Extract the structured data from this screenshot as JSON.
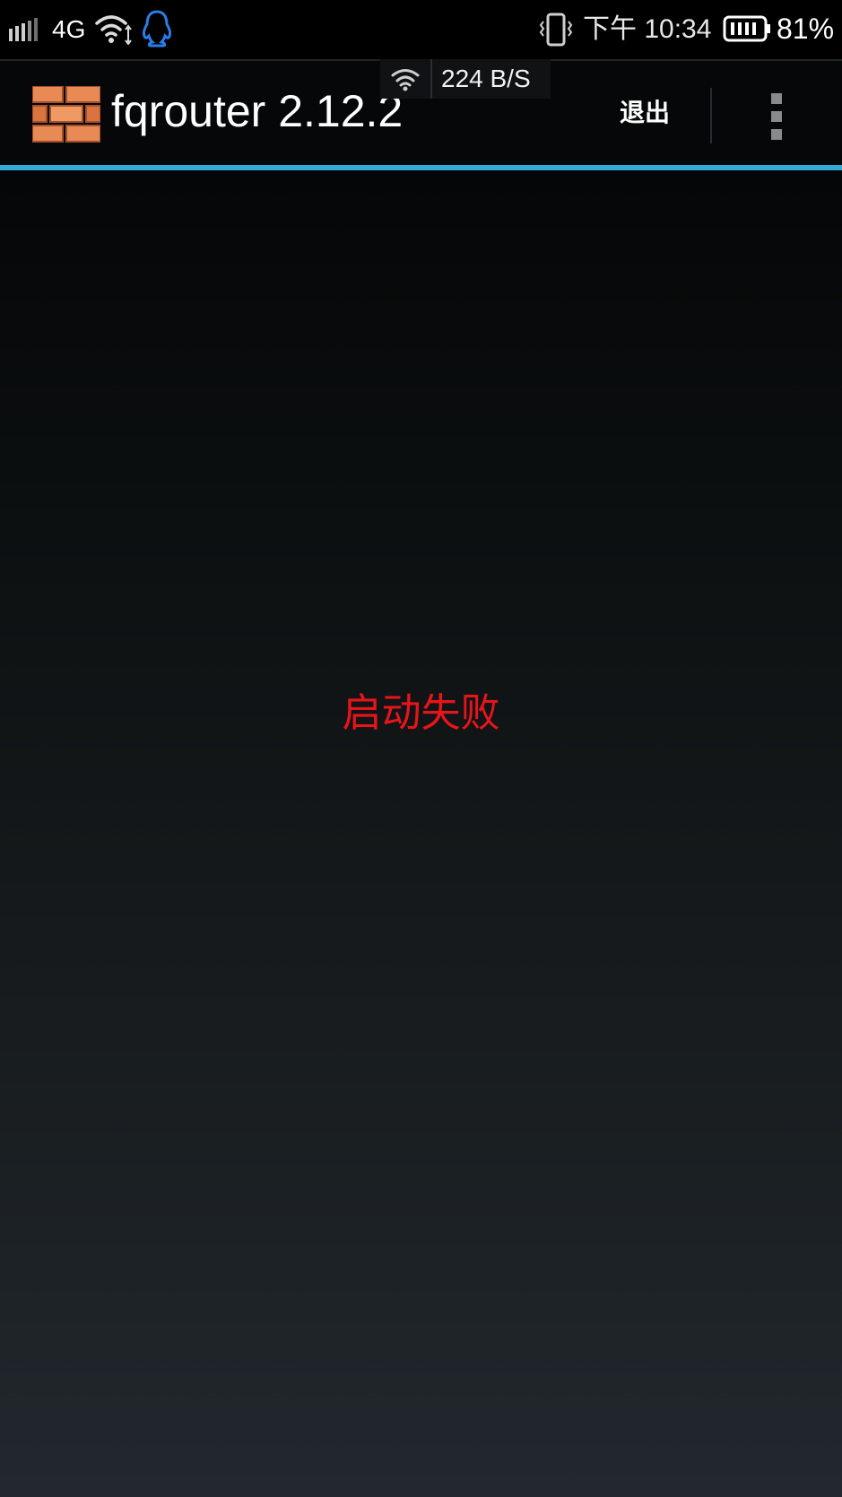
{
  "status_bar": {
    "network_type": "4G",
    "time": "下午 10:34",
    "battery_percent": "81%",
    "icons": [
      "signal-icon",
      "wifi-icon",
      "qq-icon",
      "vibrate-icon",
      "battery-icon"
    ]
  },
  "net_speed_overlay": {
    "speed": "224 B/S",
    "icon": "wifi-icon"
  },
  "action_bar": {
    "title": "fqrouter 2.12.2",
    "app_icon": "brick-wall-icon",
    "exit_label": "退出",
    "overflow_icon": "overflow-menu-icon",
    "accent_color": "#35a7d9"
  },
  "main": {
    "status_message": "启动失败",
    "status_color": "#e8141a"
  }
}
